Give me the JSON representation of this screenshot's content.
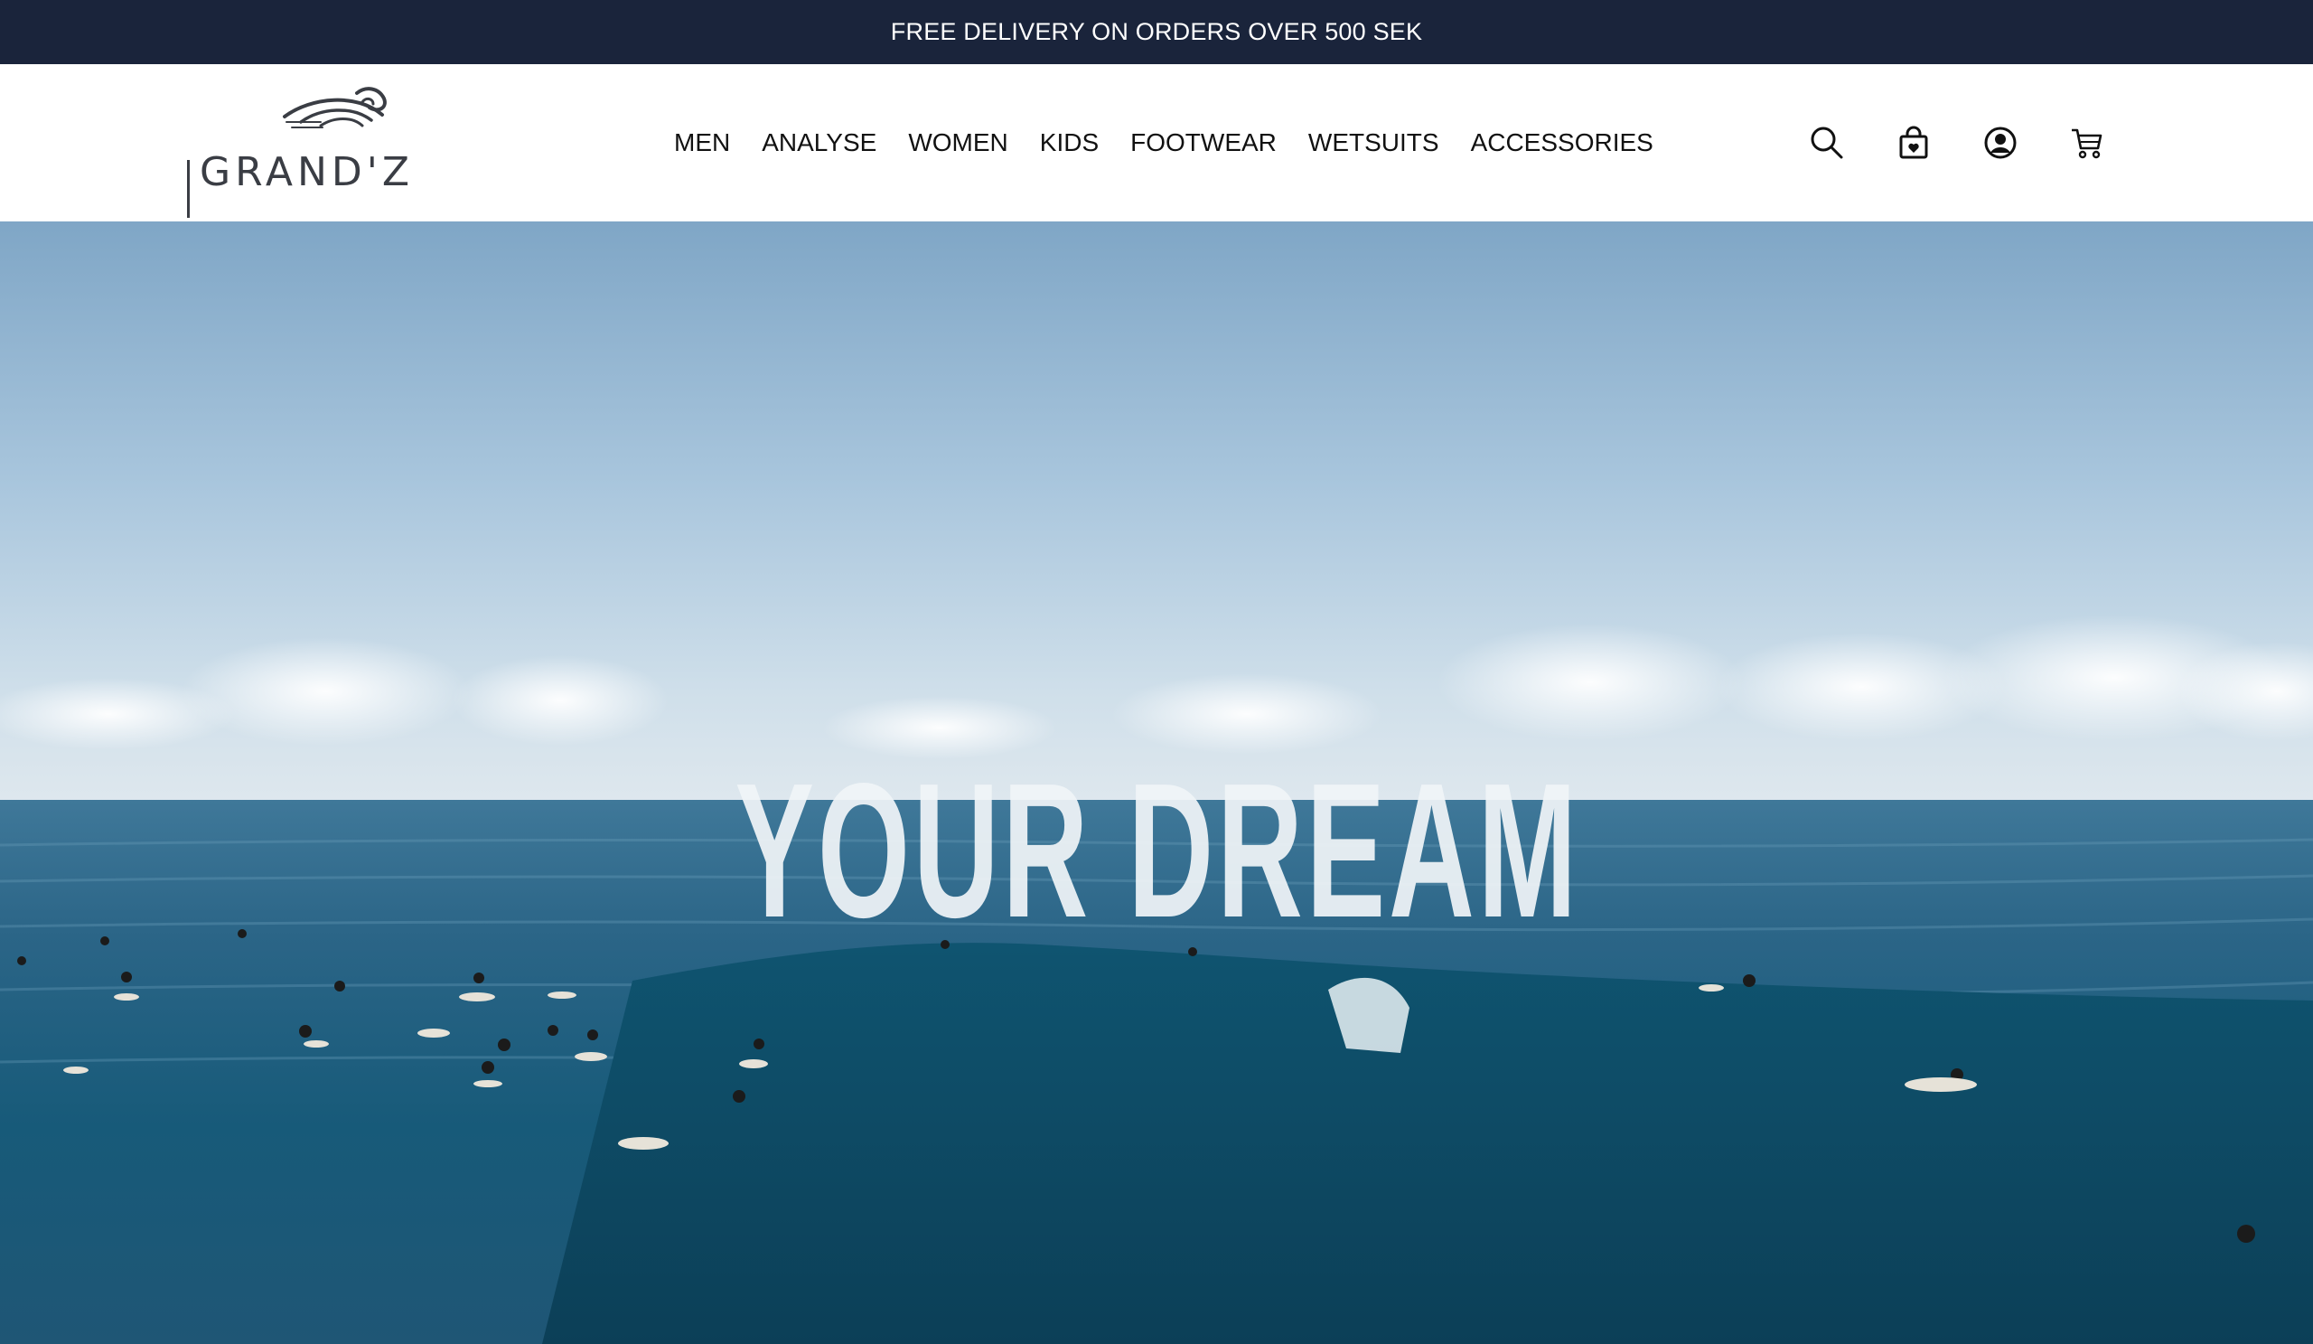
{
  "promo": {
    "text": "FREE DELIVERY ON ORDERS OVER 500 SEK"
  },
  "brand": {
    "name": "GRAND'Z"
  },
  "nav": {
    "items": [
      "MEN",
      "ANALYSE",
      "WOMEN",
      "KIDS",
      "FOOTWEAR",
      "WETSUITS",
      "ACCESSORIES"
    ]
  },
  "header_icons": [
    "search-icon",
    "shopping-bag-icon",
    "account-icon",
    "cart-icon"
  ],
  "hero": {
    "headline": "YOUR DREAM"
  },
  "colors": {
    "promo_background": "#1a243b",
    "promo_text": "#ffffff",
    "nav_text": "#111111",
    "sky_top": "#7fa6c6",
    "sea_deep": "#0f4a68"
  }
}
